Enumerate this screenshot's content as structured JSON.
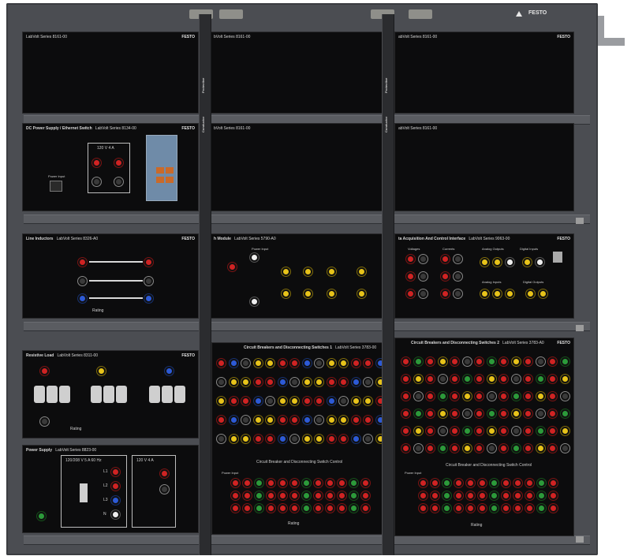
{
  "brand": "FESTO",
  "rack": {
    "vertical_labels": [
      "Protective",
      "Conductor",
      "Protective",
      "Conductor"
    ]
  },
  "modules": {
    "blank1": {
      "title": "LabVolt Series 8161-00"
    },
    "blank2": {
      "title": "bVolt Series 8161-00"
    },
    "blank3": {
      "title": "abVolt Series 8161-00"
    },
    "blank4": {
      "title": "bVolt Series 8161-00"
    },
    "blank5": {
      "title": "abVolt Series 8161-00"
    },
    "dc_power": {
      "title": "DC Power Supply / Ethernet Switch",
      "series": "LabVolt Series 8134-00",
      "rating": "120 V  4 A",
      "power_input": "Power Input"
    },
    "line_inductors": {
      "title": "Line Inductors",
      "series": "LabVolt Series 8326-A0",
      "rating_label": "Rating"
    },
    "ac_module": {
      "title": "h Module",
      "series": "LabVolt Series 5790-A0",
      "power_input": "Power Input"
    },
    "daq": {
      "title": "ta Acquisition And Control Interface",
      "series": "LabVolt Series 9063-00",
      "sections": [
        "Voltages",
        "Currents",
        "Analog Outputs",
        "Digital Inputs",
        "Analog Inputs",
        "Digital Outputs"
      ]
    },
    "resistive_load": {
      "title": "Resistive Load",
      "series": "LabVolt Series 8311-00",
      "rating_label": "Rating"
    },
    "power_supply": {
      "title": "Power Supply",
      "series": "LabVolt Series 8823-00",
      "ac_rating": "120/208 V  5 A  60 Hz",
      "dc_rating": "120 V  4 A",
      "phases": [
        "L1",
        "L2",
        "L3",
        "N"
      ]
    },
    "cb1": {
      "title": "Circuit Breakers and Disconnecting Switches 1",
      "series": "LabVolt Series 3783-00",
      "control_title": "Circuit Breaker and Disconnecting Switch Control",
      "rating_label": "Rating",
      "power_input": "Power Input"
    },
    "cb2": {
      "title": "Circuit Breakers and Disconnecting Switches 2",
      "series": "LabVolt Series 3783-A0",
      "control_title": "Circuit Breaker and Disconnecting Switch Control",
      "rating_label": "Rating",
      "power_input": "Power Input"
    }
  }
}
